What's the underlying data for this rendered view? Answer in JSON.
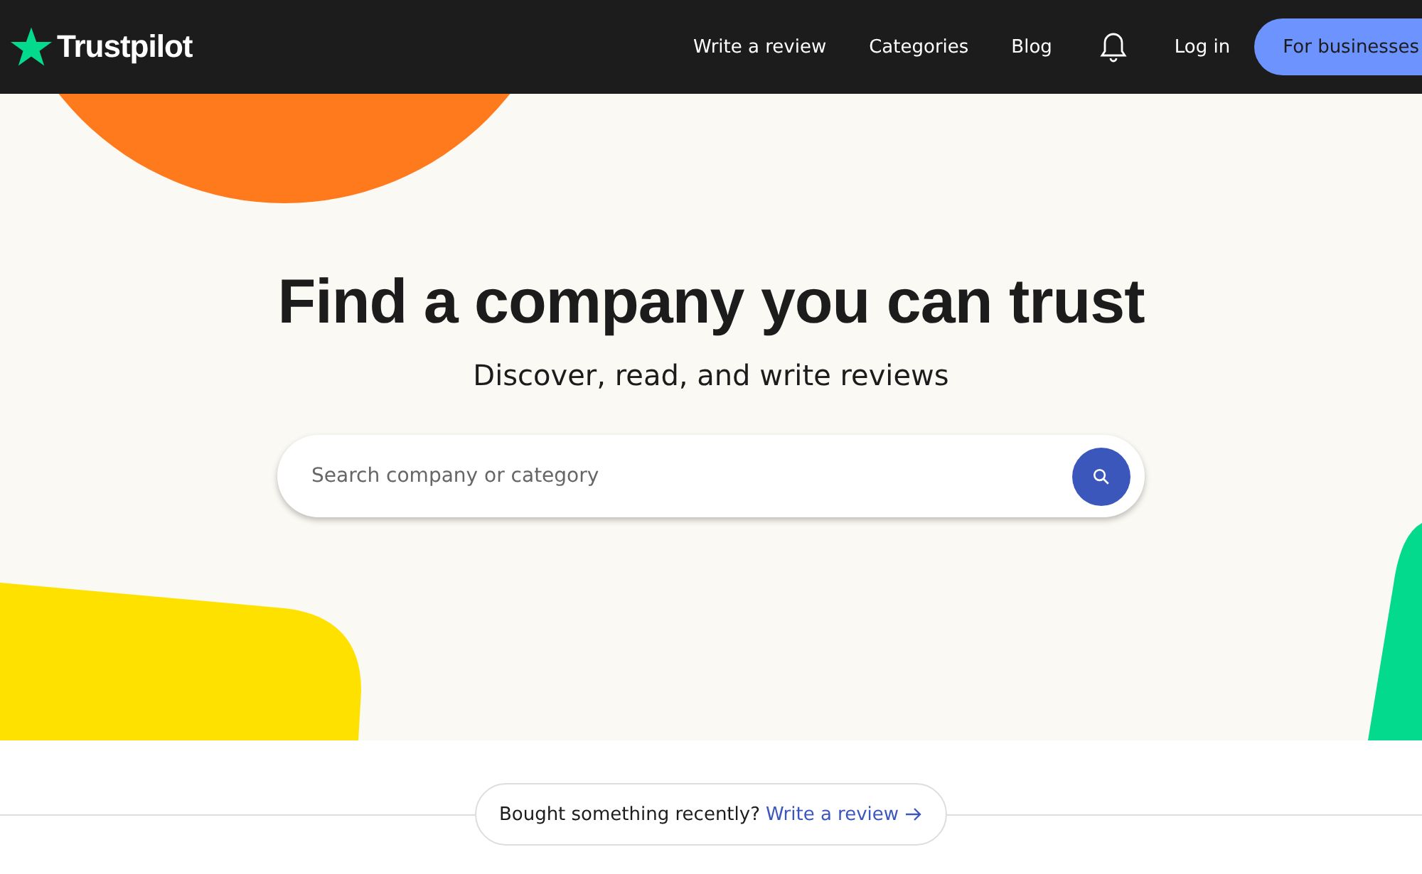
{
  "header": {
    "logo": "Trustpilot",
    "nav": [
      {
        "label": "Write a review",
        "kind": "link"
      },
      {
        "label": "Categories",
        "kind": "link"
      },
      {
        "label": "Blog",
        "kind": "link"
      },
      {
        "kind": "bell"
      },
      {
        "label": "Log in",
        "kind": "link"
      },
      {
        "label": "For businesses",
        "kind": "button"
      }
    ]
  },
  "hero": {
    "title": "Find a company you can trust",
    "subtitle": "Discover, read, and write reviews",
    "search": {
      "placeholder": "Search company or category"
    }
  },
  "prompt": {
    "text": "Bought something recently?",
    "link": "Write a review"
  }
}
